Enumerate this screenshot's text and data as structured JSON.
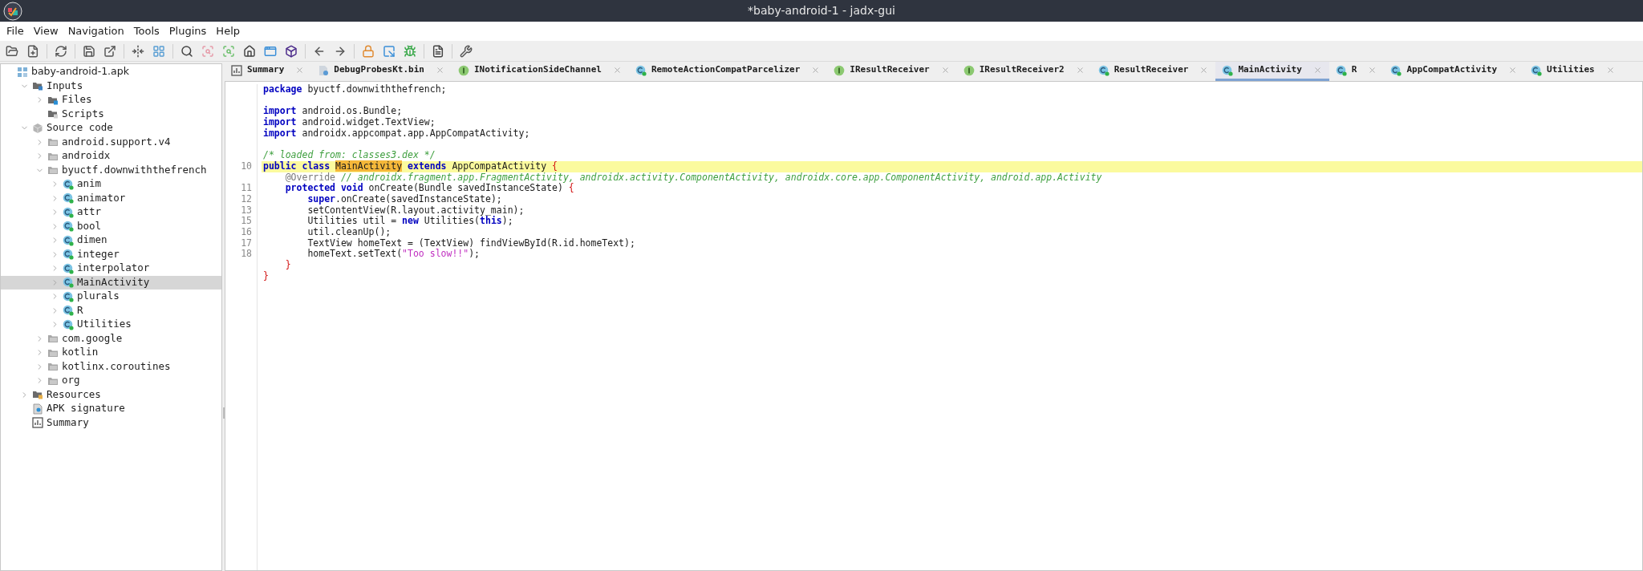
{
  "window": {
    "title": "*baby-android-1 - jadx-gui"
  },
  "menu": [
    "File",
    "View",
    "Navigation",
    "Tools",
    "Plugins",
    "Help"
  ],
  "tree": [
    {
      "label": "baby-android-1.apk",
      "kind": "apk",
      "selected": false,
      "children": [
        {
          "label": "Inputs",
          "kind": "inputs",
          "expanded": true,
          "selected": false,
          "children": [
            {
              "label": "Files",
              "kind": "files",
              "expanded": false,
              "selected": false
            },
            {
              "label": "Scripts",
              "kind": "scripts",
              "selected": false
            }
          ]
        },
        {
          "label": "Source code",
          "kind": "source",
          "expanded": true,
          "selected": false,
          "children": [
            {
              "label": "android.support.v4",
              "kind": "package",
              "expanded": false,
              "selected": false
            },
            {
              "label": "androidx",
              "kind": "package",
              "expanded": false,
              "selected": false
            },
            {
              "label": "byuctf.downwiththefrench",
              "kind": "package",
              "expanded": true,
              "selected": false,
              "children": [
                {
                  "label": "anim",
                  "kind": "class",
                  "expanded": false,
                  "selected": false
                },
                {
                  "label": "animator",
                  "kind": "class",
                  "expanded": false,
                  "selected": false
                },
                {
                  "label": "attr",
                  "kind": "class",
                  "expanded": false,
                  "selected": false
                },
                {
                  "label": "bool",
                  "kind": "class",
                  "expanded": false,
                  "selected": false
                },
                {
                  "label": "dimen",
                  "kind": "class",
                  "expanded": false,
                  "selected": false
                },
                {
                  "label": "integer",
                  "kind": "class",
                  "expanded": false,
                  "selected": false
                },
                {
                  "label": "interpolator",
                  "kind": "class",
                  "expanded": false,
                  "selected": false
                },
                {
                  "label": "MainActivity",
                  "kind": "class",
                  "expanded": false,
                  "selected": true
                },
                {
                  "label": "plurals",
                  "kind": "class",
                  "expanded": false,
                  "selected": false
                },
                {
                  "label": "R",
                  "kind": "class",
                  "expanded": false,
                  "selected": false
                },
                {
                  "label": "Utilities",
                  "kind": "class",
                  "expanded": false,
                  "selected": false
                }
              ]
            },
            {
              "label": "com.google",
              "kind": "package",
              "expanded": false,
              "selected": false
            },
            {
              "label": "kotlin",
              "kind": "package",
              "expanded": false,
              "selected": false
            },
            {
              "label": "kotlinx.coroutines",
              "kind": "package",
              "expanded": false,
              "selected": false
            },
            {
              "label": "org",
              "kind": "package",
              "expanded": false,
              "selected": false
            }
          ]
        },
        {
          "label": "Resources",
          "kind": "resources",
          "expanded": false,
          "selected": false
        },
        {
          "label": "APK signature",
          "kind": "signature",
          "selected": false
        },
        {
          "label": "Summary",
          "kind": "summary",
          "selected": false
        }
      ]
    }
  ],
  "tabs": [
    {
      "label": "Summary",
      "kind": "summary",
      "selected": false
    },
    {
      "label": "DebugProbesKt.bin",
      "kind": "file",
      "selected": false
    },
    {
      "label": "INotificationSideChannel",
      "kind": "interface",
      "selected": false
    },
    {
      "label": "RemoteActionCompatParcelizer",
      "kind": "class",
      "selected": false
    },
    {
      "label": "IResultReceiver",
      "kind": "interface",
      "selected": false
    },
    {
      "label": "IResultReceiver2",
      "kind": "interface",
      "selected": false
    },
    {
      "label": "ResultReceiver",
      "kind": "class",
      "selected": false
    },
    {
      "label": "MainActivity",
      "kind": "class",
      "selected": true
    },
    {
      "label": "R",
      "kind": "class",
      "selected": false
    },
    {
      "label": "AppCompatActivity",
      "kind": "class",
      "selected": false
    },
    {
      "label": "Utilities",
      "kind": "class",
      "selected": false
    }
  ],
  "code": [
    {
      "highlighted": false,
      "tokens": [
        {
          "kind": "keyword",
          "text": "package"
        },
        {
          "kind": "plain",
          "text": " byuctf.downwiththefrench;"
        }
      ]
    },
    {
      "highlighted": false
    },
    {
      "highlighted": false,
      "tokens": [
        {
          "kind": "keyword",
          "text": "import"
        },
        {
          "kind": "plain",
          "text": " android.os.Bundle;"
        }
      ]
    },
    {
      "highlighted": false,
      "tokens": [
        {
          "kind": "keyword",
          "text": "import"
        },
        {
          "kind": "plain",
          "text": " android.widget.TextView;"
        }
      ]
    },
    {
      "highlighted": false,
      "tokens": [
        {
          "kind": "keyword",
          "text": "import"
        },
        {
          "kind": "plain",
          "text": " androidx.appcompat.app.AppCompatActivity;"
        }
      ]
    },
    {
      "highlighted": false
    },
    {
      "highlighted": false,
      "tokens": [
        {
          "kind": "comment",
          "text": "/* loaded from: classes3.dex */"
        }
      ]
    },
    {
      "number": "10",
      "highlighted": true,
      "tokens": [
        {
          "kind": "keyword",
          "text": "public class "
        },
        {
          "kind": "mark",
          "text": "MainActivity"
        },
        {
          "kind": "keyword",
          "text": " extends"
        },
        {
          "kind": "plain",
          "text": " AppCompatActivity "
        },
        {
          "kind": "brace",
          "text": "{"
        }
      ]
    },
    {
      "highlighted": false,
      "tokens": [
        {
          "kind": "annotation",
          "text": "    @Override"
        },
        {
          "kind": "comment",
          "text": " // androidx.fragment.app.FragmentActivity, androidx.activity.ComponentActivity, androidx.core.app.ComponentActivity, android.app.Activity"
        }
      ]
    },
    {
      "number": "11",
      "highlighted": false,
      "tokens": [
        {
          "kind": "keyword",
          "text": "    protected void"
        },
        {
          "kind": "plain",
          "text": " onCreate(Bundle savedInstanceState) "
        },
        {
          "kind": "brace",
          "text": "{"
        }
      ]
    },
    {
      "number": "12",
      "highlighted": false,
      "tokens": [
        {
          "kind": "keyword",
          "text": "        super"
        },
        {
          "kind": "plain",
          "text": ".onCreate(savedInstanceState);"
        }
      ]
    },
    {
      "number": "13",
      "highlighted": false,
      "tokens": [
        {
          "kind": "plain",
          "text": "        setContentView(R.layout.activity_main);"
        }
      ]
    },
    {
      "number": "15",
      "highlighted": false,
      "tokens": [
        {
          "kind": "plain",
          "text": "        Utilities util = "
        },
        {
          "kind": "keyword",
          "text": "new"
        },
        {
          "kind": "plain",
          "text": " Utilities("
        },
        {
          "kind": "keyword",
          "text": "this"
        },
        {
          "kind": "plain",
          "text": ");"
        }
      ]
    },
    {
      "number": "16",
      "highlighted": false,
      "tokens": [
        {
          "kind": "plain",
          "text": "        util.cleanUp();"
        }
      ]
    },
    {
      "number": "17",
      "highlighted": false,
      "tokens": [
        {
          "kind": "plain",
          "text": "        TextView homeText = (TextView) findViewById(R.id.homeText);"
        }
      ]
    },
    {
      "number": "18",
      "highlighted": false,
      "tokens": [
        {
          "kind": "plain",
          "text": "        homeText.setText("
        },
        {
          "kind": "string",
          "text": "\"Too slow!!\""
        },
        {
          "kind": "plain",
          "text": ");"
        }
      ]
    },
    {
      "highlighted": false,
      "tokens": [
        {
          "kind": "brace",
          "text": "    }"
        }
      ]
    },
    {
      "highlighted": false,
      "tokens": [
        {
          "kind": "brace",
          "text": "}"
        }
      ]
    }
  ]
}
